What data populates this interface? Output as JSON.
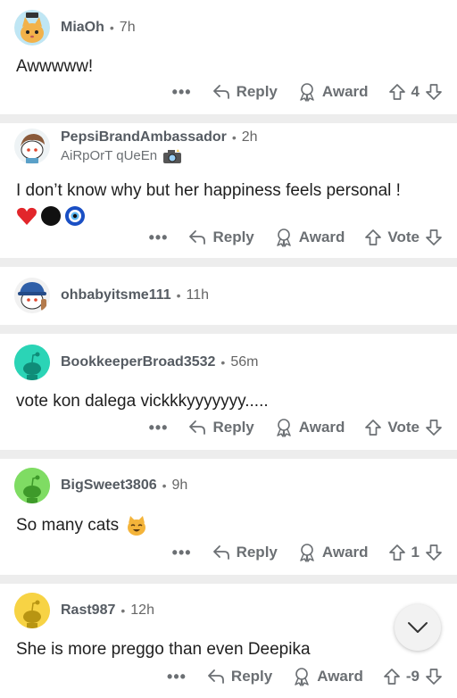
{
  "comments": [
    {
      "user": "MiaOh",
      "time": "7h",
      "flair": "",
      "text": "Awwwww!",
      "vote": "4",
      "avatar": "cat",
      "reply": "Reply",
      "award": "Award"
    },
    {
      "user": "PepsiBrandAmbassador",
      "time": "2h",
      "flair": "AiRpOrT qUeEn",
      "text": "I don’t know why but her happiness feels personal !",
      "vote": "Vote",
      "avatar": "snoo-brown",
      "reply": "Reply",
      "award": "Award"
    },
    {
      "user": "ohbabyitsme111",
      "time": "11h",
      "flair": "",
      "text": "",
      "vote": "",
      "avatar": "snoo-cap",
      "reply": "",
      "award": ""
    },
    {
      "user": "BookkeeperBroad3532",
      "time": "56m",
      "flair": "",
      "text": "vote kon dalega vickkkyyyyyyy.....",
      "vote": "Vote",
      "avatar": "#2bd4b6",
      "reply": "Reply",
      "award": "Award"
    },
    {
      "user": "BigSweet3806",
      "time": "9h",
      "flair": "",
      "text": "So many cats",
      "vote": "1",
      "avatar": "#7fdc63",
      "reply": "Reply",
      "award": "Award"
    },
    {
      "user": "Rast987",
      "time": "12h",
      "flair": "",
      "text": "She is more preggo than even Deepika",
      "vote": "-9",
      "avatar": "#f7d344",
      "reply": "Reply",
      "award": "Award"
    }
  ],
  "more_label": "•••",
  "separator_dot": "•"
}
